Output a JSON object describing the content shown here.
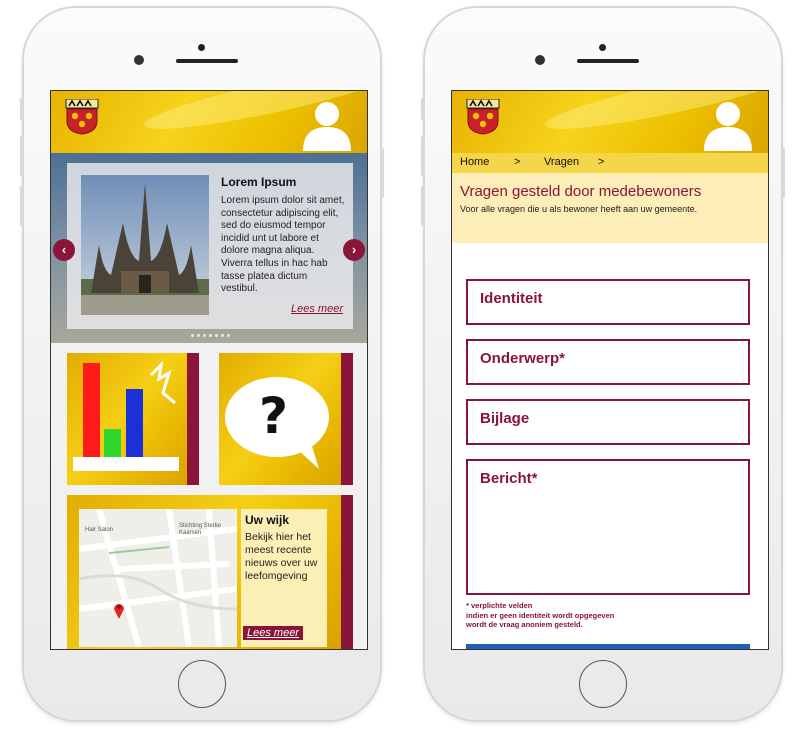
{
  "home_screen": {
    "slider": {
      "title": "Lorem Ipsum",
      "text": "Lorem ipsum dolor sit amet, consectetur adipiscing elit, sed do eiusmod tempor incidid unt ut labore et dolore magna aliqua. Viverra tellus in hac hab tasse platea dictum vestibul.",
      "link": "Lees meer",
      "prev_arrow": "‹",
      "next_arrow": "›"
    },
    "tile_question": {
      "symbol": "?"
    },
    "tile_map": {
      "title": "Uw wijk",
      "text": "Bekijk hier het meest recente nieuws over uw leefomgeving",
      "link": "Lees meer",
      "map_label_1": "Hair Salon",
      "map_label_2": "Stichting Sterke Kaarsen"
    }
  },
  "form_screen": {
    "breadcrumb": {
      "home": "Home",
      "sep1": ">",
      "current": "Vragen",
      "sep2": ">"
    },
    "info": {
      "title": "Vragen gesteld door medebewoners",
      "subtitle": "Voor alle vragen die u als bewoner heeft aan uw gemeente."
    },
    "fields": {
      "identiteit": "Identiteit",
      "onderwerp": "Onderwerp*",
      "bijlage": "Bijlage",
      "bericht": "Bericht*"
    },
    "notes": {
      "line1": "* verplichte velden",
      "line2": "indien er geen identiteit wordt opgegeven",
      "line3": "wordt de vraag anoniem gesteld."
    }
  },
  "colors": {
    "accent": "#8a1538",
    "header_yellow": "#f0c400",
    "info_box": "#fdedb8",
    "button_blue": "#1f5fbf"
  },
  "icons": {
    "crest": "municipality-crest-icon",
    "user": "user-profile-icon",
    "map_pin": "map-pin-icon"
  }
}
